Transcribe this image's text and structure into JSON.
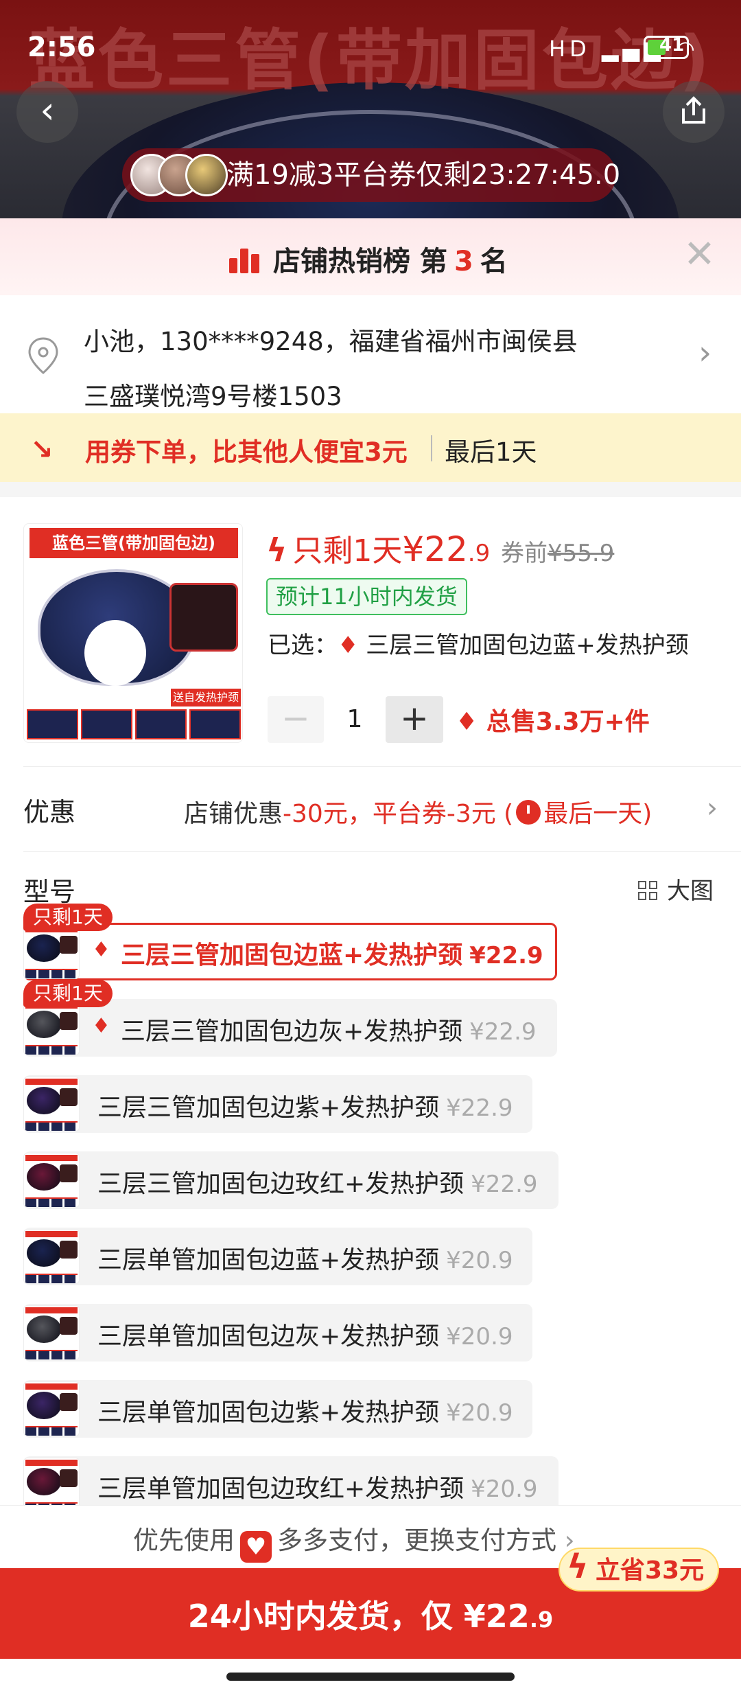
{
  "status_bar": {
    "time": "2:56",
    "signal": "HD",
    "battery": "41"
  },
  "banner": {
    "title": "蓝色三管(带加固包边)",
    "coupon_text": "满19减3平台券仅剩23:27:45.0"
  },
  "hot_rank": {
    "label": "店铺热销榜 第",
    "rank": "3",
    "suffix": "名"
  },
  "address": {
    "line1": "小池，130****9248，福建省福州市闽侯县",
    "line2": "三盛璞悦湾9号楼1503"
  },
  "promo": {
    "text": "用券下单，比其他人便宜3元",
    "deadline": "最后1天"
  },
  "product": {
    "thumb_tag": "蓝色三管(带加固包边)",
    "thumb_badge": "送自发热护颈",
    "left_days": "只剩1天",
    "currency": "¥",
    "price_int": "22",
    "price_dec": ".9",
    "before_label": "券前",
    "before_price": "¥55.9",
    "ship_tag": "预计11小时内发货",
    "selected_label": "已选：",
    "selected_value": "三层三管加固包边蓝+发热护颈",
    "quantity": "1",
    "total_sales": "总售3.3万+件"
  },
  "discount": {
    "label": "优惠",
    "shop_label": "店铺优惠",
    "shop_value": "-30元，",
    "platform": "平台券-3元 (",
    "last_day": "最后一天)"
  },
  "models": {
    "label": "型号",
    "big_view": "大图",
    "limit_tag": "只剩1天",
    "items": [
      {
        "name": "三层三管加固包边蓝+发热护颈",
        "price": "¥22.9",
        "color": "#1a2350"
      },
      {
        "name": "三层三管加固包边灰+发热护颈",
        "price": "¥22.9",
        "color": "#55565c"
      },
      {
        "name": "三层三管加固包边紫+发热护颈",
        "price": "¥22.9",
        "color": "#3b2566"
      },
      {
        "name": "三层三管加固包边玫红+发热护颈",
        "price": "¥22.9",
        "color": "#6a1838"
      },
      {
        "name": "三层单管加固包边蓝+发热护颈",
        "price": "¥20.9",
        "color": "#1a2350"
      },
      {
        "name": "三层单管加固包边灰+发热护颈",
        "price": "¥20.9",
        "color": "#55565c"
      },
      {
        "name": "三层单管加固包边紫+发热护颈",
        "price": "¥20.9",
        "color": "#3b2566"
      },
      {
        "name": "三层单管加固包边玫红+发热护颈",
        "price": "¥20.9",
        "color": "#6a1838"
      }
    ]
  },
  "pay": {
    "prefix": "优先使用",
    "text": "多多支付，更换支付方式"
  },
  "cta": {
    "label": "24小时内发货，仅 ¥22",
    "decimal": ".9",
    "save_badge": "立省33元"
  },
  "colors": {
    "accent": "#e02e24",
    "ship_green": "#21a045",
    "promo_bg": "#fdf4cc"
  }
}
